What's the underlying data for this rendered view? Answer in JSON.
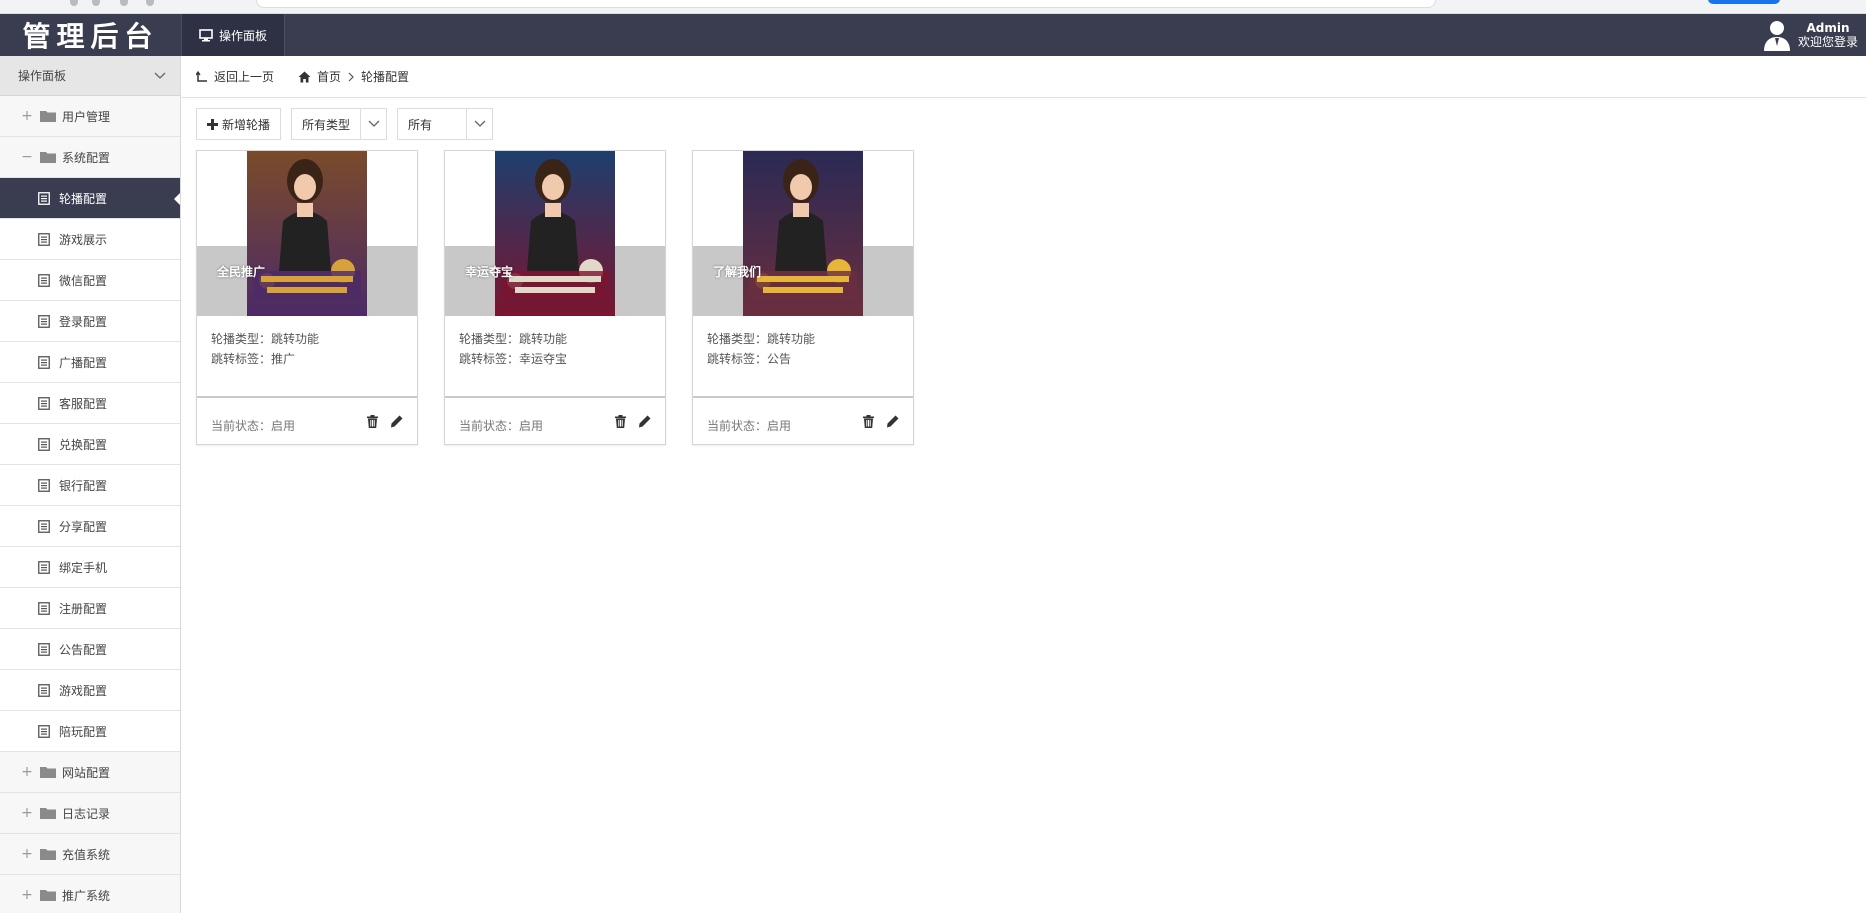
{
  "app": {
    "logo_text": "管理后台",
    "top_tab_label": "操作面板",
    "user_name": "Admin",
    "user_welcome": "欢迎您登录"
  },
  "sidebar": {
    "header_label": "操作面板",
    "items": [
      {
        "type": "group",
        "sign": "+",
        "label": "用户管理"
      },
      {
        "type": "group",
        "sign": "−",
        "label": "系统配置"
      },
      {
        "type": "sub",
        "label": "轮播配置",
        "active": true
      },
      {
        "type": "sub",
        "label": "游戏展示"
      },
      {
        "type": "sub",
        "label": "微信配置"
      },
      {
        "type": "sub",
        "label": "登录配置"
      },
      {
        "type": "sub",
        "label": "广播配置"
      },
      {
        "type": "sub",
        "label": "客服配置"
      },
      {
        "type": "sub",
        "label": "兑换配置"
      },
      {
        "type": "sub",
        "label": "银行配置"
      },
      {
        "type": "sub",
        "label": "分享配置"
      },
      {
        "type": "sub",
        "label": "绑定手机"
      },
      {
        "type": "sub",
        "label": "注册配置"
      },
      {
        "type": "sub",
        "label": "公告配置"
      },
      {
        "type": "sub",
        "label": "游戏配置"
      },
      {
        "type": "sub",
        "label": "陪玩配置"
      },
      {
        "type": "group",
        "sign": "+",
        "label": "网站配置"
      },
      {
        "type": "group",
        "sign": "+",
        "label": "日志记录"
      },
      {
        "type": "group",
        "sign": "+",
        "label": "充值系统"
      },
      {
        "type": "group",
        "sign": "+",
        "label": "推广系统"
      }
    ]
  },
  "breadcrumb": {
    "back_label": "返回上一页",
    "home_label": "首页",
    "current_label": "轮播配置"
  },
  "toolbar": {
    "add_label": "新增轮播",
    "type_select_value": "所有类型",
    "status_select_value": "所有"
  },
  "cards": [
    {
      "caption": "全民推广",
      "type_line": "轮播类型：跳转功能",
      "tag_line": "跳转标签：推广",
      "status_line": "当前状态：启用",
      "poster_palette": [
        "#7a4b2a",
        "#4c2a66",
        "#d8a23a"
      ]
    },
    {
      "caption": "幸运夺宝",
      "type_line": "轮播类型：跳转功能",
      "tag_line": "跳转标签：幸运夺宝",
      "status_line": "当前状态：启用",
      "poster_palette": [
        "#1d3f6e",
        "#7a1530",
        "#e1d9c8"
      ]
    },
    {
      "caption": "了解我们",
      "type_line": "轮播类型：跳转功能",
      "tag_line": "跳转标签：公告",
      "status_line": "当前状态：启用",
      "poster_palette": [
        "#2b2a55",
        "#6a2e3e",
        "#e7b53a"
      ]
    }
  ],
  "colors": {
    "header_bg": "#393d4f",
    "active_item_bg": "#393d4f",
    "caption_band": "#c8c8c8"
  }
}
